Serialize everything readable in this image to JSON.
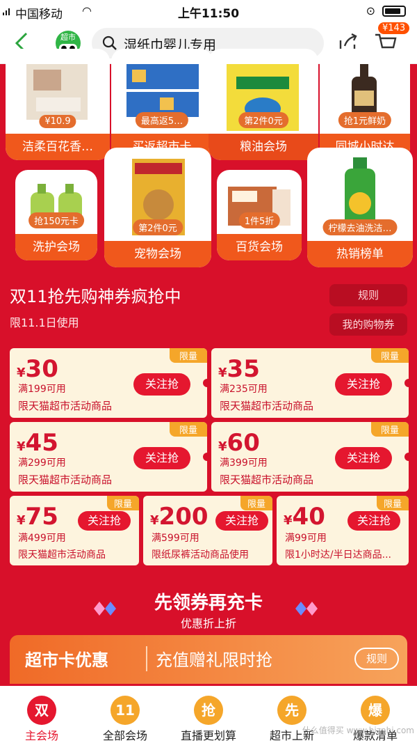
{
  "status": {
    "carrier": "中国移动",
    "time": "上午11:50"
  },
  "nav": {
    "logo_text": "超市",
    "logo_face": "●.●",
    "search_query": "湿纸巾婴儿专用",
    "cart_count": "143"
  },
  "tiles_row1": [
    {
      "label": "洁柔百花香…",
      "tag": "¥10.9"
    },
    {
      "label": "买返超市卡",
      "tag": "最高返5…"
    },
    {
      "label": "粮油会场",
      "tag": "第2件0元"
    },
    {
      "label": "同城小时达",
      "tag": "抢1元鲜奶"
    }
  ],
  "tiles_row2": [
    {
      "label": "洗护会场",
      "tag": "抢150元卡"
    },
    {
      "label": "宠物会场",
      "tag": "第2件0元"
    },
    {
      "label": "百货会场",
      "tag": "1件5折"
    },
    {
      "label": "热销榜单",
      "tag": "柠檬去油洗洁…"
    }
  ],
  "coupon_section": {
    "title": "双11抢先购神券疯抢中",
    "subtitle": "限11.1日使用",
    "rules": "规则",
    "my_coupons": "我的购物券"
  },
  "coupons": [
    {
      "limit": "限量",
      "currency": "¥",
      "amount": "30",
      "cond": "满199可用",
      "scope": "限天猫超市活动商品",
      "btn": "关注抢"
    },
    {
      "limit": "限量",
      "currency": "¥",
      "amount": "35",
      "cond": "满235可用",
      "scope": "限天猫超市活动商品",
      "btn": "关注抢"
    },
    {
      "limit": "限量",
      "currency": "¥",
      "amount": "45",
      "cond": "满299可用",
      "scope": "限天猫超市活动商品",
      "btn": "关注抢"
    },
    {
      "limit": "限量",
      "currency": "¥",
      "amount": "60",
      "cond": "满399可用",
      "scope": "限天猫超市活动商品",
      "btn": "关注抢"
    },
    {
      "limit": "限量",
      "currency": "¥",
      "amount": "75",
      "cond": "满499可用",
      "scope": "限天猫超市活动商品",
      "btn": "关注抢"
    },
    {
      "limit": "限量",
      "currency": "¥",
      "amount": "200",
      "cond": "满599可用",
      "scope": "限纸尿裤活动商品使用",
      "btn": "关注抢"
    },
    {
      "limit": "限量",
      "currency": "¥",
      "amount": "40",
      "cond": "满99可用",
      "scope": "限1小时达/半日达商品...",
      "btn": "关注抢"
    }
  ],
  "card_section": {
    "title": "先领券再充卡",
    "subtitle": "优惠折上折",
    "banner_left": "超市卡优惠",
    "banner_right": "充值赠礼限时抢",
    "rules": "规则"
  },
  "tabs": [
    {
      "icon": "双",
      "label": "主会场",
      "color": "#e5172f"
    },
    {
      "icon": "11",
      "label": "全部会场",
      "color": "#f5a62a"
    },
    {
      "icon": "抢",
      "label": "直播更划算",
      "color": "#f5a62a"
    },
    {
      "icon": "先",
      "label": "超市上新",
      "color": "#f5a62a"
    },
    {
      "icon": "爆",
      "label": "爆款清单",
      "color": "#f5a62a"
    }
  ],
  "watermark": "什么值得买 www.hiznhi.com"
}
